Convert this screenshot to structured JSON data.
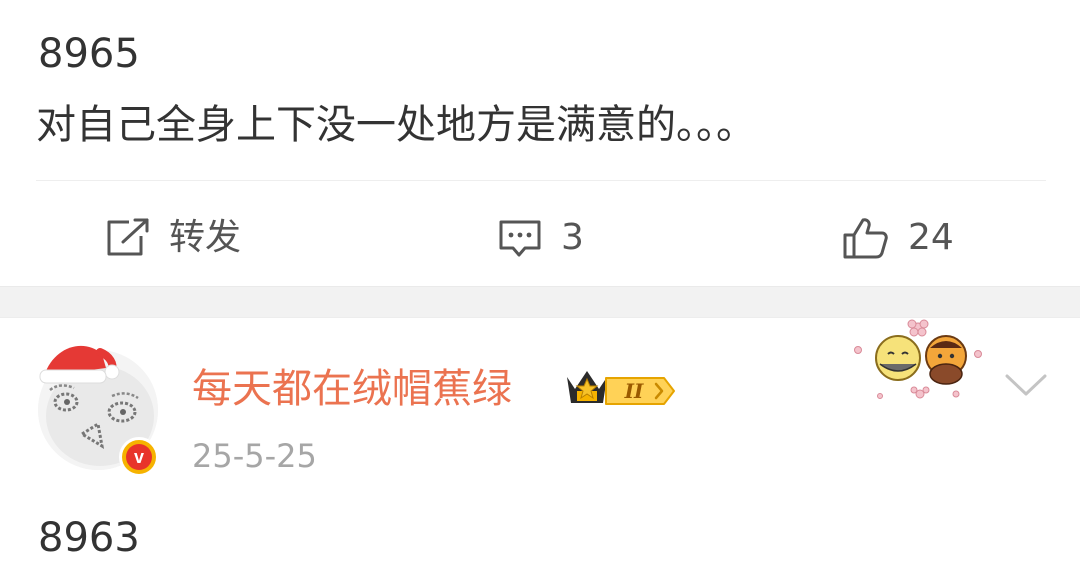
{
  "post1": {
    "number": "8965",
    "text": "对自己全身上下没一处地方是满意的。。。"
  },
  "actions": {
    "repost": {
      "label": "转发",
      "icon": "repost-icon"
    },
    "comment": {
      "count": "3",
      "icon": "comment-icon"
    },
    "like": {
      "count": "24",
      "icon": "thumbs-up-icon"
    }
  },
  "post2": {
    "username": "每天都在绒帽蕉绿",
    "level_badge": "II",
    "date": "25-5-25",
    "number": "8963",
    "verified_badge": "v",
    "avatar_icon": "cartoon-face-avatar",
    "decoration_icon": "cute-faces-sticker"
  },
  "colors": {
    "username": "#eb7350",
    "text": "#333333",
    "muted": "#a6a6a6",
    "icon": "#555555",
    "separator": "#f2f2f2",
    "badge_gold": "#f6b300",
    "badge_red": "#e8342a"
  }
}
